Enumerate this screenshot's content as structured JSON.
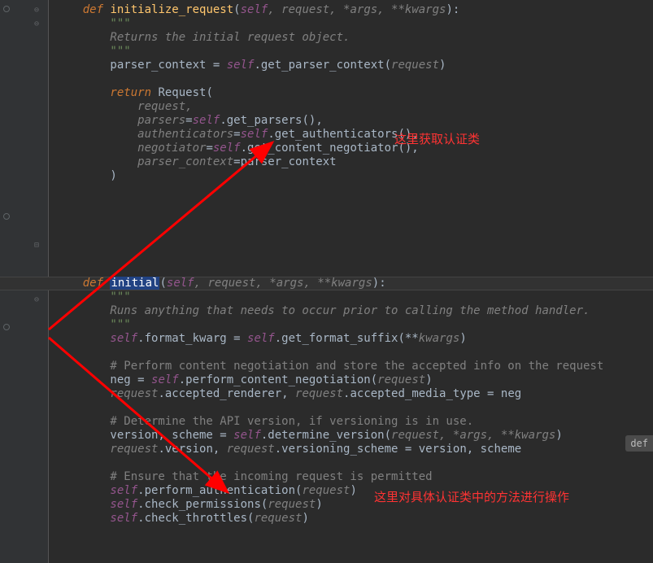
{
  "code": {
    "l1": {
      "def": "def ",
      "name": "initialize_request",
      "open": "(",
      "self": "self",
      "params": ", request, *args, **kwargs",
      "close": "):"
    },
    "l2": "        \"\"\"",
    "l3": "        Returns the initial request object.",
    "l4": "        \"\"\"",
    "l5": {
      "pre": "        parser_context = ",
      "self": "self",
      "dot": ".get_parser_context(",
      "arg": "request",
      "end": ")"
    },
    "l6": "",
    "l7": {
      "ret": "        return ",
      "call": "Request("
    },
    "l8": {
      "arg": "            request,"
    },
    "l9": {
      "kw": "            parsers",
      "eq": "=",
      "self": "self",
      "rest": ".get_parsers(),"
    },
    "l10": {
      "kw": "            authenticators",
      "eq": "=",
      "self": "self",
      "rest": ".get_authenticators(),"
    },
    "l11": {
      "kw": "            negotiator",
      "eq": "=",
      "self": "self",
      "rest": ".get_content_negotiator(),"
    },
    "l12": {
      "kw": "            parser_context",
      "eq": "=",
      "rest": "parser_context"
    },
    "l13": "        )",
    "l14": "",
    "l15": {
      "def": "    def ",
      "name": "initial",
      "open": "(",
      "self": "self",
      "params": ", request, *args, **kwargs",
      "close": "):"
    },
    "l16": "        \"\"\"",
    "l17": "        Runs anything that needs to occur prior to calling the method handler.",
    "l18": "        \"\"\"",
    "l19": {
      "self": "        self",
      "rest1": ".format_kwarg = ",
      "self2": "self",
      "rest2": ".get_format_suffix(**",
      "arg": "kwargs",
      "end": ")"
    },
    "l20": "",
    "l21": "        # Perform content negotiation and store the accepted info on the request",
    "l22": {
      "pre": "        neg = ",
      "self": "self",
      "rest": ".perform_content_negotiation(",
      "arg": "request",
      "end": ")"
    },
    "l23": {
      "arg1": "        request",
      "rest1": ".accepted_renderer, ",
      "arg2": "request",
      "rest2": ".accepted_media_type = neg"
    },
    "l24": "",
    "l25": "        # Determine the API version, if versioning is in use.",
    "l26": {
      "pre": "        version, scheme = ",
      "self": "self",
      "rest": ".determine_version(",
      "args": "request, *args, **kwargs",
      "end": ")"
    },
    "l27": {
      "arg1": "        request",
      "rest1": ".version, ",
      "arg2": "request",
      "rest2": ".versioning_scheme = version, scheme"
    },
    "l28": "",
    "l29": "        # Ensure that the incoming request is permitted",
    "l30": {
      "self": "        self",
      "rest": ".perform_authentication(",
      "arg": "request",
      "end": ")"
    },
    "l31": {
      "self": "        self",
      "rest": ".check_permissions(",
      "arg": "request",
      "end": ")"
    },
    "l32": {
      "self": "        self",
      "rest": ".check_throttles(",
      "arg": "request",
      "end": ")"
    }
  },
  "annotations": {
    "a1": "这里获取认证类",
    "a2": "这里对具体认证类中的方法进行操作"
  },
  "badge": "def "
}
